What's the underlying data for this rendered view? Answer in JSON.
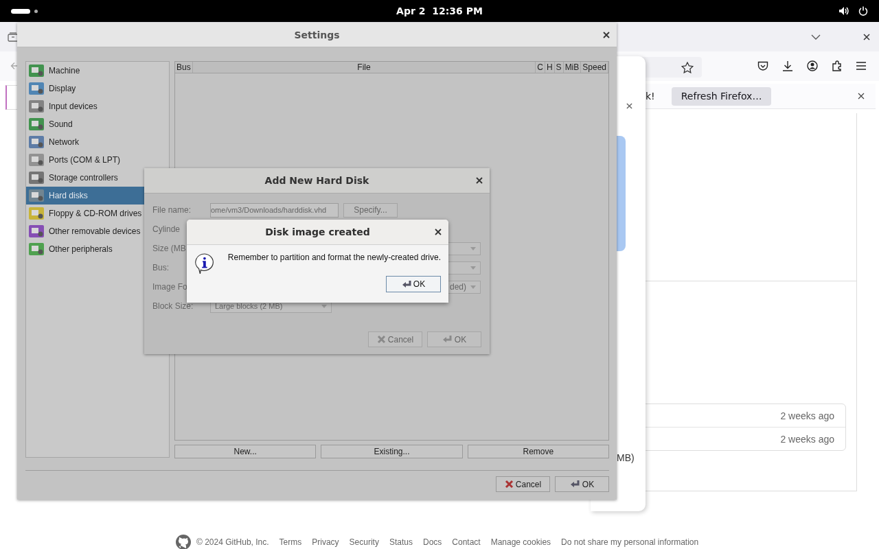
{
  "top_bar": {
    "clock": "Apr 2  12:36 PM"
  },
  "browser": {
    "notification": {
      "message": "k!",
      "button": "Refresh Firefox…"
    },
    "popup": {
      "text": "MB)"
    },
    "history_rows": [
      {
        "time": "2 weeks ago"
      },
      {
        "time": "2 weeks ago"
      }
    ],
    "footer": {
      "copyright": "© 2024 GitHub, Inc.",
      "links": [
        "Terms",
        "Privacy",
        "Security",
        "Status",
        "Docs",
        "Contact",
        "Manage cookies",
        "Do not share my personal information"
      ]
    }
  },
  "settings": {
    "title": "Settings",
    "categories": [
      {
        "label": "Machine",
        "selected": false
      },
      {
        "label": "Display",
        "selected": false
      },
      {
        "label": "Input devices",
        "selected": false
      },
      {
        "label": "Sound",
        "selected": false
      },
      {
        "label": "Network",
        "selected": false
      },
      {
        "label": "Ports (COM & LPT)",
        "selected": false
      },
      {
        "label": "Storage controllers",
        "selected": false
      },
      {
        "label": "Hard disks",
        "selected": true
      },
      {
        "label": "Floppy & CD-ROM drives",
        "selected": false
      },
      {
        "label": "Other removable devices",
        "selected": false
      },
      {
        "label": "Other peripherals",
        "selected": false
      }
    ],
    "table": {
      "columns": [
        "Bus",
        "File",
        "C",
        "H",
        "S",
        "MiB",
        "Speed"
      ]
    },
    "table_buttons": [
      "New...",
      "Existing...",
      "Remove"
    ],
    "buttons": [
      {
        "label": "Cancel",
        "kind": "cancel"
      },
      {
        "label": "OK",
        "kind": "ok"
      }
    ]
  },
  "add_disk_dialog": {
    "title": "Add New Hard Disk",
    "fields": [
      {
        "label": "File name:",
        "kind": "text",
        "value": "ome/vm3/Downloads/harddisk.vhd",
        "button": "Specify..."
      },
      {
        "label": "Cylinde",
        "kind": "hidden"
      },
      {
        "label": "Size (MB",
        "kind": "dropdown"
      },
      {
        "label": "Bus:",
        "kind": "dropdown"
      },
      {
        "label": "Image Fo",
        "kind": "dropdown",
        "value": "ded)"
      },
      {
        "label": "Block Size:",
        "kind": "wide-dropdown",
        "value": "Large blocks (2 MB)"
      }
    ],
    "buttons": [
      {
        "label": "Cancel",
        "kind": "cancel",
        "disabled": true
      },
      {
        "label": "OK",
        "kind": "ok",
        "disabled": true
      }
    ]
  },
  "message_dialog": {
    "title": "Disk image created",
    "message": "Remember to partition and format the newly-created drive.",
    "button": "OK"
  }
}
